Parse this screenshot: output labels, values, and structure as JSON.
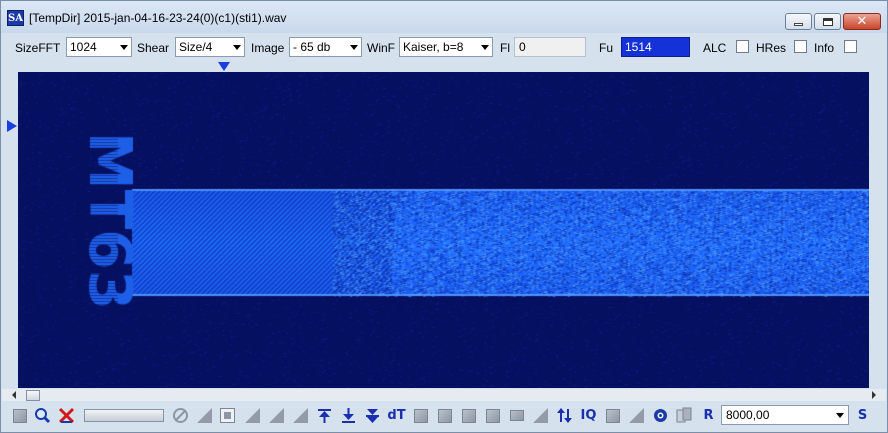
{
  "window": {
    "app_icon": "SA",
    "title": "[TempDir] 2015-jan-04-16-23-24(0)(c1)(sti1).wav",
    "controls": [
      "minimize-icon",
      "maximize-icon",
      "close-icon"
    ],
    "close_glyph": "✕"
  },
  "toolbar": {
    "sizefft_label": "SizeFFT",
    "sizefft_value": "1024",
    "shear_label": "Shear",
    "shear_value": "Size/4",
    "image_label": "Image",
    "image_value": "- 65 db",
    "winf_label": "WinF",
    "winf_value": "Kaiser, b=8",
    "fl_label": "Fl",
    "fl_value": "0",
    "fu_label": "Fu",
    "fu_value": "1514",
    "alc_label": "ALC",
    "alc_checked": false,
    "hres_label": "HRes",
    "hres_checked": false,
    "info_label": "Info",
    "info_checked": false
  },
  "spectrogram": {
    "background_color": "#061060",
    "signal_color": "#1e6cff",
    "embedded_text": "MT63"
  },
  "bottom_toolbar": {
    "icons": [
      "zoom-icon",
      "cancel-icon",
      "no-entry-icon",
      "stop-icon",
      "arrow-up-icon",
      "arrow-down-icon",
      "double-arrow-icon",
      "dt-icon",
      "swap-icon",
      "iq-icon",
      "settings-gear-icon",
      "copy-icon",
      "r-icon",
      "s-icon"
    ],
    "dt_label": "dT",
    "iq_label": "IQ",
    "r_label": "R",
    "s_label": "S",
    "sample_rate": "8000,00"
  }
}
